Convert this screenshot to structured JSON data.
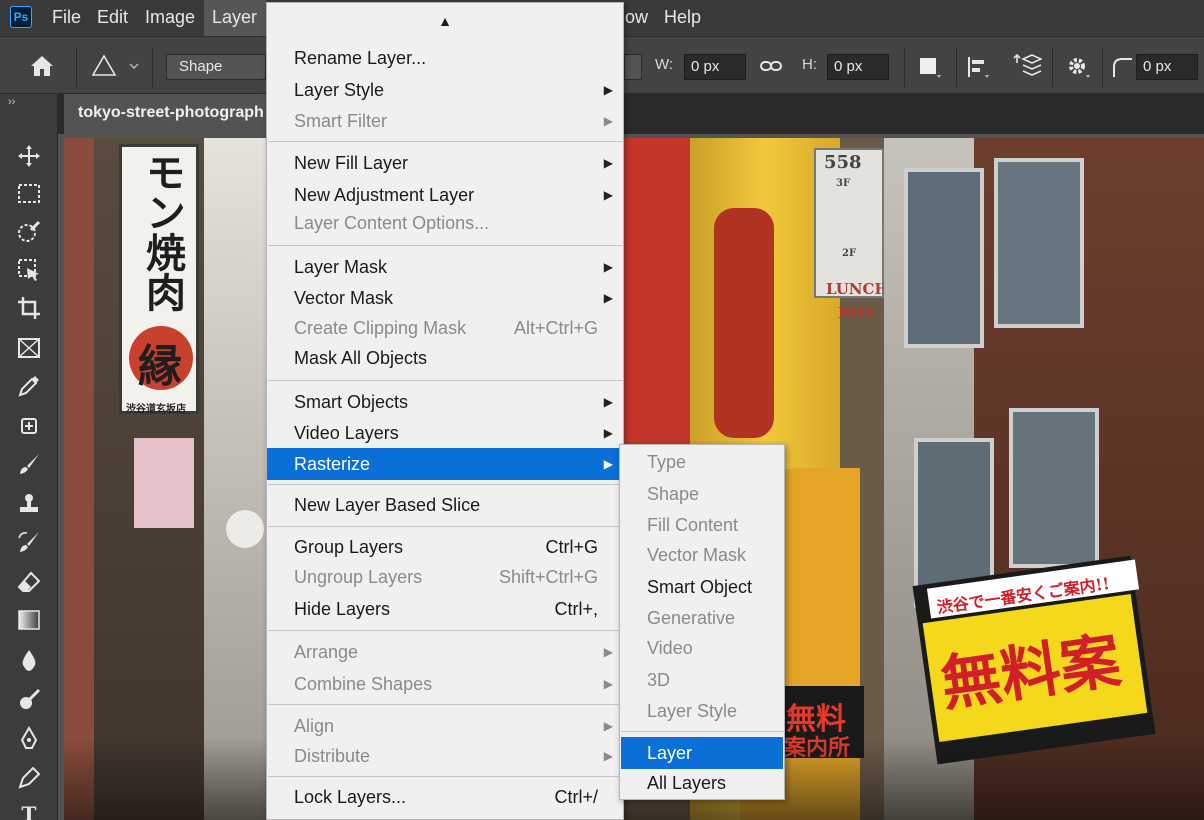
{
  "menubar": {
    "logo": "Ps",
    "items": [
      "File",
      "Edit",
      "Image",
      "Layer",
      "",
      "ow",
      "Help"
    ]
  },
  "options": {
    "mode_select": "Shape",
    "w_label": "W:",
    "w_value": "0 px",
    "h_label": "H:",
    "h_value": "0 px",
    "radius_value": "0 px"
  },
  "document": {
    "tab_title": "tokyo-street-photograph"
  },
  "canvas_signs": {
    "left_sign": "モン焼肉",
    "left_emblem": "縁",
    "left_small": "渋谷道玄坂店",
    "building_number": "558",
    "floor_3f": "3F",
    "floor_2f": "2F",
    "lunch": "LUNCH",
    "box": "BOX",
    "banner": "渋谷で一番安くご案内!!",
    "free_big": "無料案",
    "free_small": "無料",
    "guide": "案内所"
  },
  "layer_menu": {
    "items": [
      {
        "label": "Rename Layer...",
        "shortcut": "",
        "submenu": false,
        "disabled": false
      },
      {
        "label": "Layer Style",
        "shortcut": "",
        "submenu": true,
        "disabled": false
      },
      {
        "label": "Smart Filter",
        "shortcut": "",
        "submenu": true,
        "disabled": true
      },
      {
        "label": "New Fill Layer",
        "shortcut": "",
        "submenu": true,
        "disabled": false
      },
      {
        "label": "New Adjustment Layer",
        "shortcut": "",
        "submenu": true,
        "disabled": false
      },
      {
        "label": "Layer Content Options...",
        "shortcut": "",
        "submenu": false,
        "disabled": true
      },
      {
        "label": "Layer Mask",
        "shortcut": "",
        "submenu": true,
        "disabled": false
      },
      {
        "label": "Vector Mask",
        "shortcut": "",
        "submenu": true,
        "disabled": false
      },
      {
        "label": "Create Clipping Mask",
        "shortcut": "Alt+Ctrl+G",
        "submenu": false,
        "disabled": true
      },
      {
        "label": "Mask All Objects",
        "shortcut": "",
        "submenu": false,
        "disabled": false
      },
      {
        "label": "Smart Objects",
        "shortcut": "",
        "submenu": true,
        "disabled": false
      },
      {
        "label": "Video Layers",
        "shortcut": "",
        "submenu": true,
        "disabled": false
      },
      {
        "label": "Rasterize",
        "shortcut": "",
        "submenu": true,
        "disabled": false,
        "highlighted": true
      },
      {
        "label": "New Layer Based Slice",
        "shortcut": "",
        "submenu": false,
        "disabled": false
      },
      {
        "label": "Group Layers",
        "shortcut": "Ctrl+G",
        "submenu": false,
        "disabled": false
      },
      {
        "label": "Ungroup Layers",
        "shortcut": "Shift+Ctrl+G",
        "submenu": false,
        "disabled": true
      },
      {
        "label": "Hide Layers",
        "shortcut": "Ctrl+,",
        "submenu": false,
        "disabled": false
      },
      {
        "label": "Arrange",
        "shortcut": "",
        "submenu": true,
        "disabled": true
      },
      {
        "label": "Combine Shapes",
        "shortcut": "",
        "submenu": true,
        "disabled": true
      },
      {
        "label": "Align",
        "shortcut": "",
        "submenu": true,
        "disabled": true
      },
      {
        "label": "Distribute",
        "shortcut": "",
        "submenu": true,
        "disabled": true
      },
      {
        "label": "Lock Layers...",
        "shortcut": "Ctrl+/",
        "submenu": false,
        "disabled": false
      }
    ]
  },
  "rasterize_menu": {
    "items": [
      {
        "label": "Type",
        "disabled": true
      },
      {
        "label": "Shape",
        "disabled": true
      },
      {
        "label": "Fill Content",
        "disabled": true
      },
      {
        "label": "Vector Mask",
        "disabled": true
      },
      {
        "label": "Smart Object",
        "disabled": false
      },
      {
        "label": "Generative",
        "disabled": true
      },
      {
        "label": "Video",
        "disabled": true
      },
      {
        "label": "3D",
        "disabled": true
      },
      {
        "label": "Layer Style",
        "disabled": true
      },
      {
        "label": "Layer",
        "disabled": false,
        "highlighted": true
      },
      {
        "label": "All Layers",
        "disabled": false
      }
    ]
  },
  "icons": {
    "home": "home-icon",
    "shape": "triangle-shape-icon",
    "link": "link-icon",
    "settings": "gear-icon"
  },
  "colors": {
    "highlight": "#0a6fd6",
    "menu_bg": "#f0f0f0",
    "ps_blue": "#31a8ff"
  }
}
